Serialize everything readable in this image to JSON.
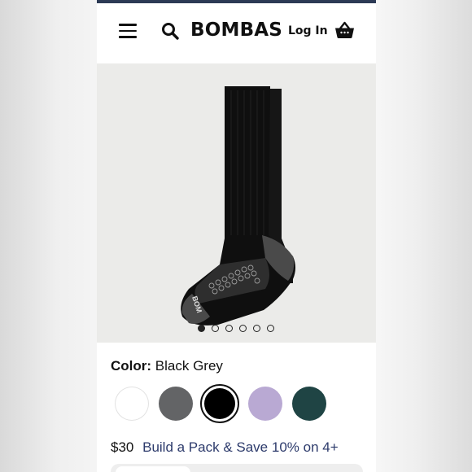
{
  "header": {
    "logo": "BOMBAS",
    "login_label": "Log In",
    "icons": [
      "hamburger-menu-icon",
      "search-icon",
      "shopping-basket-icon"
    ],
    "accent_bar_color": "#2c3a55"
  },
  "gallery": {
    "image_count": 6,
    "active_index": 0
  },
  "color_picker": {
    "label": "Color:",
    "selected_name": "Black Grey",
    "swatches": [
      {
        "name": "white",
        "hex": "#ffffff"
      },
      {
        "name": "grey",
        "hex": "#636466"
      },
      {
        "name": "black",
        "hex": "#000000",
        "selected": true
      },
      {
        "name": "lavender",
        "hex": "#b9a9d3"
      },
      {
        "name": "dark-green",
        "hex": "#1f4444"
      }
    ]
  },
  "pricing": {
    "price": "$30",
    "pack_offer": "Build a Pack & Save 10% on 4+"
  }
}
